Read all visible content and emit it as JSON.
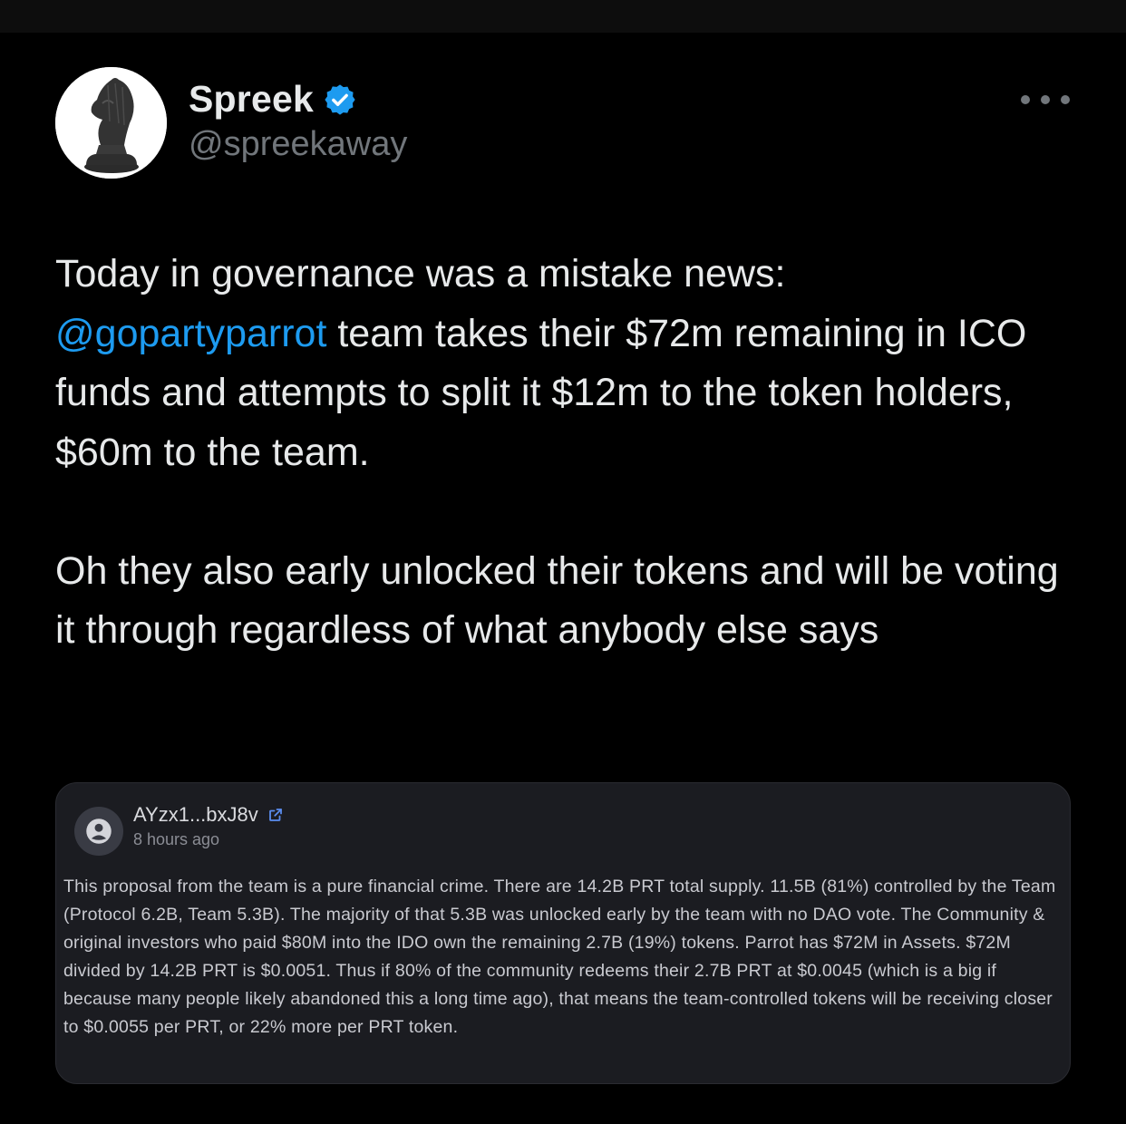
{
  "author": {
    "display_name": "Spreek",
    "handle": "@spreekaway",
    "verified": true
  },
  "tweet": {
    "paragraph1_prefix": "Today in governance was a mistake news:",
    "mention": "@gopartyparrot",
    "paragraph1_suffix": " team takes their $72m remaining in ICO funds and attempts to split it $12m to the token holders, $60m to the team.",
    "paragraph2": "Oh they also early unlocked their tokens and will be voting it through regardless of what anybody else says"
  },
  "quoted_card": {
    "username": "AYzx1...bxJ8v",
    "time": "8 hours ago",
    "text": "This proposal from the team is a pure financial crime. There are 14.2B PRT total supply. 11.5B (81%) controlled by the Team (Protocol 6.2B, Team 5.3B). The majority of that 5.3B was unlocked early by the team with no DAO vote. The Community & original investors who paid $80M into the IDO own the remaining 2.7B (19%) tokens. Parrot has $72M in Assets. $72M divided by 14.2B PRT is $0.0051. Thus if 80% of the community redeems their 2.7B PRT at $0.0045 (which is a big if because many people likely abandoned this a long time ago), that means the team-controlled tokens will be receiving closer to $0.0055 per PRT, or 22% more per PRT token."
  },
  "colors": {
    "background": "#000000",
    "text": "#e7e9ea",
    "secondary_text": "#71767b",
    "link": "#1d9bf0",
    "verified_badge": "#1d9bf0",
    "card_background": "#1b1c21"
  },
  "icons": {
    "avatar": "chess-knight-avatar",
    "verified": "verified-badge-icon",
    "more": "more-horizontal-icon",
    "card_avatar": "user-placeholder-icon",
    "external_link": "external-link-icon"
  }
}
